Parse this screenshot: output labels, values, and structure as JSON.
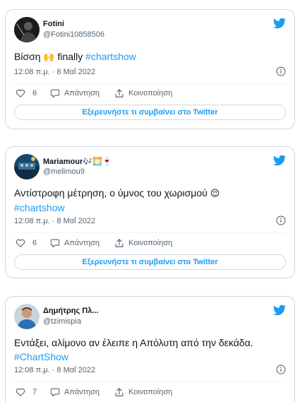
{
  "tweets": [
    {
      "name": "Fotini",
      "handle": "@Fotini10858506",
      "text_before": "Βίσση ",
      "emoji": "🙌",
      "text_after": " finally  ",
      "hashtag": "#chartshow",
      "timestamp": "12:08 π.μ. · 8 Μαΐ 2022",
      "likes": "6",
      "reply_label": "Απάντηση",
      "share_label": "Κοινοποίηση",
      "explore_label": "Εξερευνήστε τι συμβαίνει στο Twitter"
    },
    {
      "name": "Mariamour",
      "name_emojis": "🎶🌅🍷",
      "handle": "@melimou9",
      "text": "Αντίστροφη μέτρηση, ο ύμνος του χωρισμού ",
      "emoji": "😌",
      "hashtag": "#chartshow",
      "timestamp": "12:08 π.μ. · 8 Μαΐ 2022",
      "likes": "6",
      "reply_label": "Απάντηση",
      "share_label": "Κοινοποίηση",
      "explore_label": "Εξερευνήστε τι συμβαίνει στο Twitter"
    },
    {
      "name": "Δημήτρης Πλ...",
      "handle": "@tzimispia",
      "text": "Εντάξει, αλίμονο αν έλειπε η Απόλυτη από την δεκάδα.",
      "hashtag": "#ChartShow",
      "timestamp": "12:08 π.μ. · 8 Μαΐ 2022",
      "likes": "7",
      "reply_label": "Απάντηση",
      "share_label": "Κοινοποίηση"
    }
  ],
  "colors": {
    "accent": "#1d9bf0",
    "text": "#0f1419",
    "secondary": "#536471",
    "border": "#cfd9de"
  },
  "icons": [
    "twitter-bird-icon",
    "heart-icon",
    "reply-icon",
    "share-icon",
    "info-icon"
  ]
}
